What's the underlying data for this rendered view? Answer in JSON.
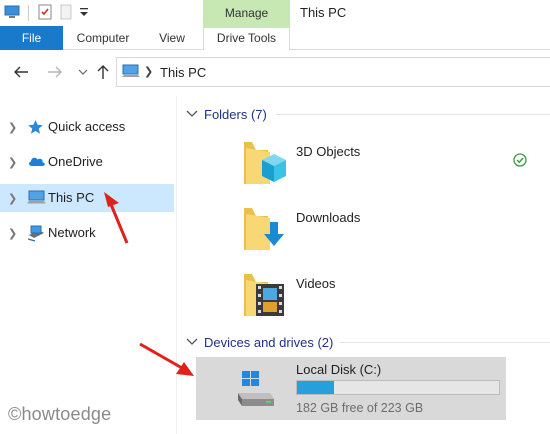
{
  "window": {
    "title": "This PC"
  },
  "ribbon": {
    "context_tab": "Manage",
    "tabs": [
      {
        "label": "File"
      },
      {
        "label": "Computer"
      },
      {
        "label": "View"
      },
      {
        "label": "Drive Tools"
      }
    ]
  },
  "address": {
    "path": "This PC"
  },
  "navpane": {
    "items": [
      {
        "label": "Quick access",
        "icon": "star-icon"
      },
      {
        "label": "OneDrive",
        "icon": "cloud-icon"
      },
      {
        "label": "This PC",
        "icon": "computer-icon",
        "selected": true
      },
      {
        "label": "Network",
        "icon": "network-icon"
      }
    ]
  },
  "content": {
    "folders_header": "Folders (7)",
    "folders": [
      {
        "name": "3D Objects",
        "icon": "3d-objects-folder-icon",
        "status": "synced-check-icon"
      },
      {
        "name": "Downloads",
        "icon": "downloads-folder-icon"
      },
      {
        "name": "Videos",
        "icon": "videos-folder-icon"
      }
    ],
    "drives_header": "Devices and drives (2)",
    "drives": [
      {
        "name": "Local Disk (C:)",
        "free_text": "182 GB free of 223 GB",
        "used_fraction": 0.184
      }
    ]
  },
  "watermark": "©howtoedge",
  "colors": {
    "accent": "#1979ca",
    "manage_tab": "#c7e8b3",
    "selection": "#cce8ff",
    "group_header": "#1e3287",
    "drive_fill": "#26a0da",
    "annotation_arrow": "#e0201b"
  }
}
